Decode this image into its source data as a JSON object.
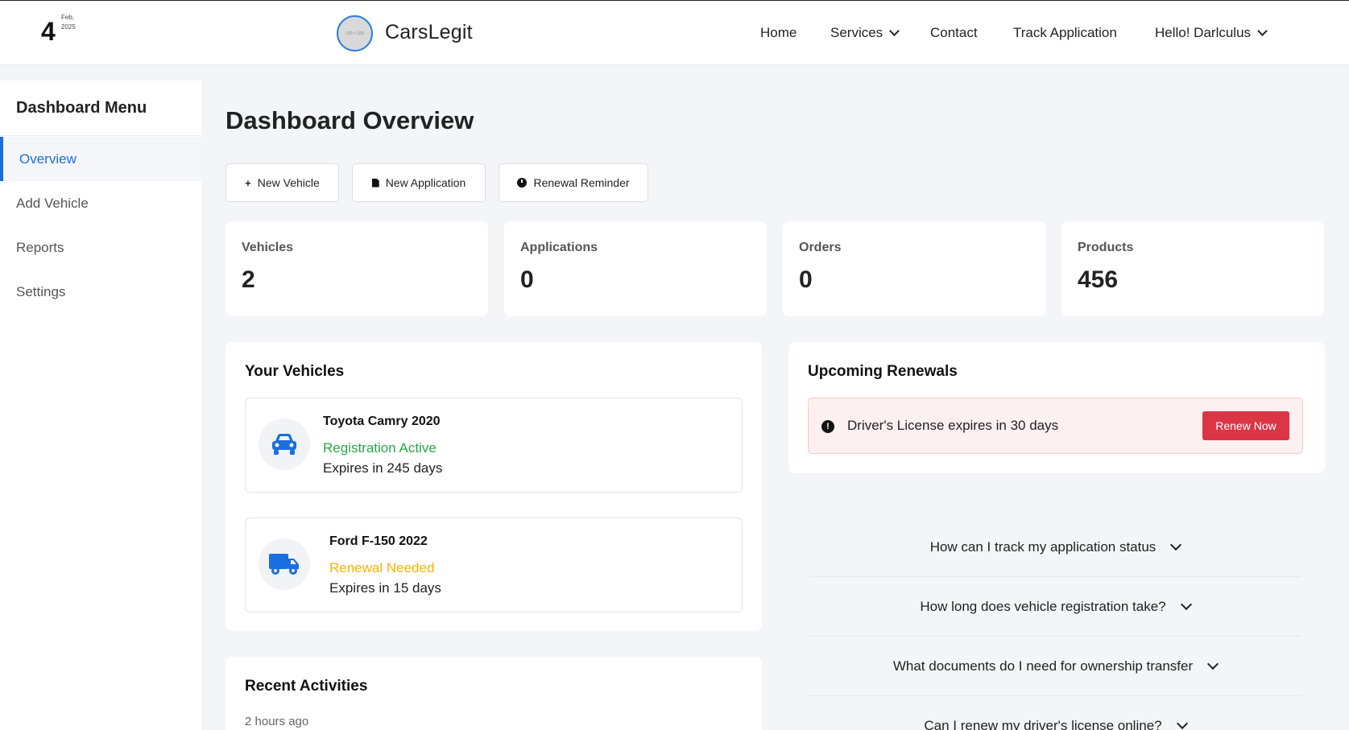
{
  "header": {
    "date_day": "4",
    "date_month": "Feb,",
    "date_year": "2025",
    "logo_placeholder": "100 × 100",
    "brand": "CarsLegit",
    "nav": {
      "home": "Home",
      "services": "Services",
      "contact": "Contact",
      "track": "Track Application",
      "user": "Hello! Darlculus"
    }
  },
  "sidebar": {
    "title": "Dashboard Menu",
    "items": [
      {
        "label": "Overview",
        "active": true
      },
      {
        "label": "Add Vehicle"
      },
      {
        "label": "Reports"
      },
      {
        "label": "Settings"
      }
    ]
  },
  "main": {
    "title": "Dashboard Overview",
    "actions": {
      "new_vehicle": "New Vehicle",
      "new_application": "New Application",
      "renewal_reminder": "Renewal Reminder"
    },
    "stats": [
      {
        "label": "Vehicles",
        "value": "2"
      },
      {
        "label": "Applications",
        "value": "0"
      },
      {
        "label": "Orders",
        "value": "0"
      },
      {
        "label": "Products",
        "value": "456"
      }
    ],
    "vehicles": {
      "title": "Your Vehicles",
      "items": [
        {
          "name": "Toyota Camry 2020",
          "status": "Registration Active",
          "status_color": "#28a745",
          "expiry": "Expires in 245 days",
          "icon": "car-icon"
        },
        {
          "name": "Ford F-150 2022",
          "status": "Renewal Needed",
          "status_color": "#f5b400",
          "expiry": "Expires in 15 days",
          "icon": "truck-icon"
        }
      ]
    },
    "renewals": {
      "title": "Upcoming Renewals",
      "alert_text": "Driver's License expires in 30 days",
      "button": "Renew Now"
    },
    "faq": [
      "How can I track my application status",
      "How long does vehicle registration take?",
      "What documents do I need for ownership transfer",
      "Can I renew my driver's license online?"
    ],
    "activities": {
      "title": "Recent Activities",
      "first_time": "2 hours ago"
    }
  },
  "colors": {
    "accent": "#1a6fe0",
    "danger": "#dc3545",
    "success": "#28a745",
    "warning": "#f5b400",
    "background": "#f4f5f8"
  }
}
